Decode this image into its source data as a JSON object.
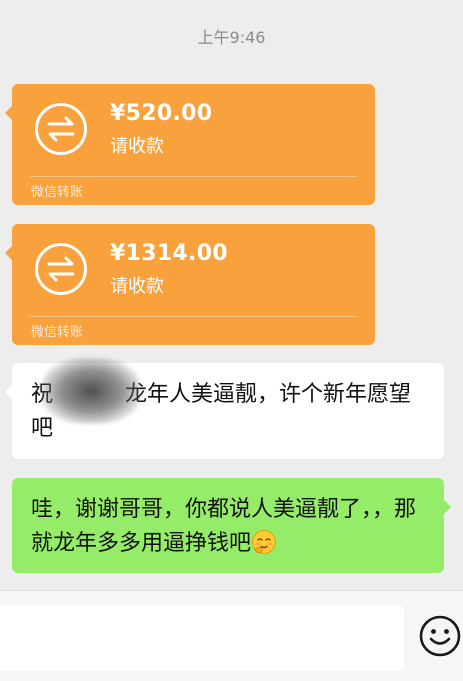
{
  "chat": {
    "timestamp": "上午9:46",
    "transfers": [
      {
        "amount": "¥520.00",
        "status": "请收款",
        "footer": "微信转账"
      },
      {
        "amount": "¥1314.00",
        "status": "请收款",
        "footer": "微信转账"
      }
    ],
    "incoming_message": {
      "text_part1": "祝",
      "text_part2": "龙年人美逼靓，许个新年愿望吧"
    },
    "outgoing_message": {
      "text": "哇，谢谢哥哥，你都说人美逼靓了，，那就龙年多多用逼挣钱吧",
      "emoji": "blushing-face-emoji"
    }
  },
  "input_bar": {
    "placeholder": "",
    "emoji_button_icon": "smiley-face-icon"
  },
  "colors": {
    "background": "#ededed",
    "transfer_card": "#f9a13c",
    "outgoing_bubble": "#95ec69",
    "incoming_bubble": "#ffffff"
  }
}
